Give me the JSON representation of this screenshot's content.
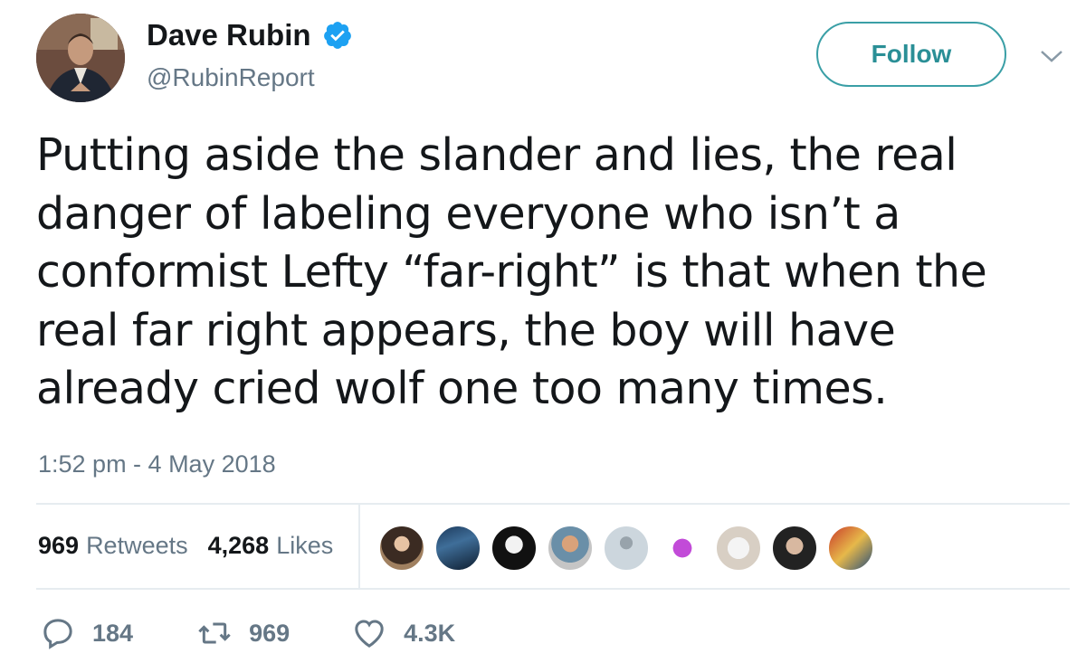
{
  "user": {
    "display_name": "Dave Rubin",
    "handle": "@RubinReport"
  },
  "follow_label": "Follow",
  "tweet": {
    "text": "Putting aside the slander and lies, the real danger of labeling everyone who isn’t a conformist Lefty “far-right” is that when the real far right appears, the boy will have already cried wolf one too many times.",
    "timestamp": "1:52 pm - 4 May 2018"
  },
  "stats": {
    "retweets_count": "969",
    "retweets_label": "Retweets",
    "likes_count": "4,268",
    "likes_label": "Likes"
  },
  "liker_avatars": [
    "liker-avatar-1",
    "liker-avatar-2",
    "liker-avatar-3",
    "liker-avatar-4",
    "liker-avatar-5",
    "liker-avatar-6",
    "liker-avatar-7",
    "liker-avatar-8",
    "liker-avatar-9"
  ],
  "actions": {
    "replies": "184",
    "retweets": "969",
    "likes": "4.3K"
  },
  "colors": {
    "verified": "#1da1f2",
    "follow": "#2a8f96",
    "muted": "#657786"
  }
}
